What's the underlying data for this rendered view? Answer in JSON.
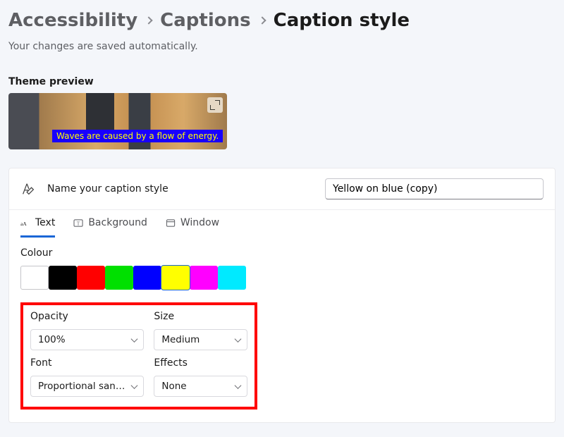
{
  "breadcrumb": {
    "0": "Accessibility",
    "1": "Captions",
    "2": "Caption style"
  },
  "save_note": "Your changes are saved automatically.",
  "theme_preview_label": "Theme preview",
  "caption_sample": "Waves are caused by a flow of energy.",
  "name_section": {
    "label": "Name your caption style",
    "value": "Yellow on blue (copy)"
  },
  "tabs": {
    "text": "Text",
    "background": "Background",
    "window": "Window"
  },
  "colour": {
    "label": "Colour",
    "swatches": [
      "white",
      "black",
      "red",
      "green",
      "blue",
      "yellow",
      "magenta",
      "cyan"
    ],
    "selected": "yellow"
  },
  "settings": {
    "opacity_label": "Opacity",
    "opacity_value": "100%",
    "size_label": "Size",
    "size_value": "Medium",
    "font_label": "Font",
    "font_value": "Proportional san…",
    "effects_label": "Effects",
    "effects_value": "None"
  }
}
